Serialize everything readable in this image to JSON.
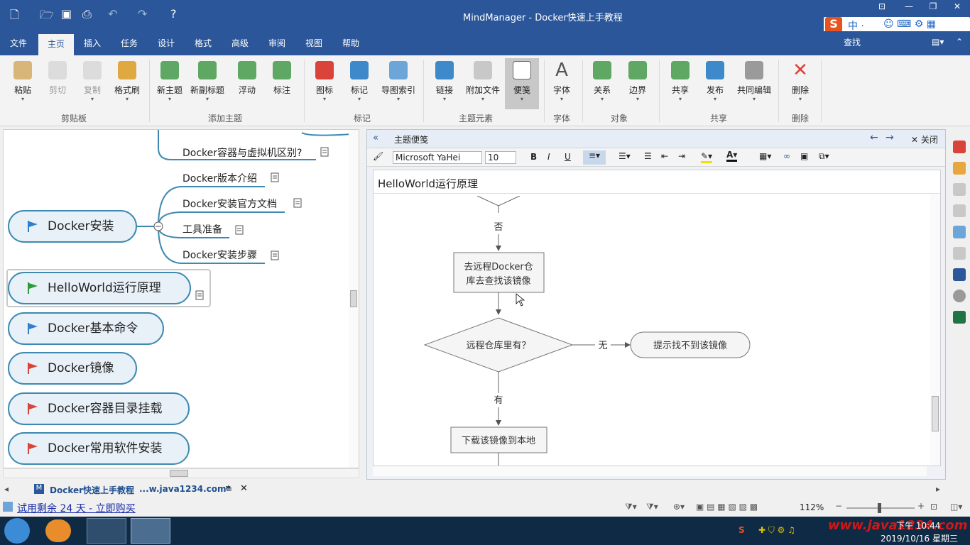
{
  "app": {
    "title": "MindManager - Docker快速上手教程"
  },
  "menu": {
    "items": [
      "文件",
      "主页",
      "插入",
      "任务",
      "设计",
      "格式",
      "高级",
      "审阅",
      "视图",
      "帮助"
    ],
    "search_label": "查找"
  },
  "ribbon": {
    "buttons": [
      "粘贴",
      "剪切",
      "复制",
      "格式刷",
      "新主题",
      "新副标题",
      "浮动",
      "标注",
      "图标",
      "标记",
      "导图索引",
      "链接",
      "附加文件",
      "便笺",
      "字体",
      "关系",
      "边界",
      "共享",
      "发布",
      "共同编辑",
      "删除"
    ],
    "groups": [
      "剪贴板",
      "添加主题",
      "标记",
      "主题元素",
      "字体",
      "对象",
      "共享",
      "删除"
    ]
  },
  "map": {
    "subtopics": [
      "Docker容器与虚拟机区别?",
      "Docker版本介绍",
      "Docker安装官方文档",
      "工具准备",
      "Docker安装步骤"
    ],
    "topics": [
      "Docker安装",
      "HelloWorld运行原理",
      "Docker基本命令",
      "Docker镜像",
      "Docker容器目录挂载",
      "Docker常用软件安装"
    ]
  },
  "note": {
    "header_title": "主题便笺",
    "close_label": "关闭",
    "font_name": "Microsoft YaHei",
    "font_size": "10",
    "title": "HelloWorld运行原理",
    "flow": {
      "no_label": "否",
      "box1_line1": "去远程Docker仓",
      "box1_line2": "库去查找该镜像",
      "decision": "远程仓库里有？",
      "none_label": "无",
      "not_found": "提示找不到该镜像",
      "yes_label": "有",
      "download": "下载该镜像到本地"
    }
  },
  "doc_tab": {
    "name": "Docker快速上手教程",
    "path": "...w.java1234.com*"
  },
  "status": {
    "trial": "试用剩余 24 天 - 立即购买",
    "zoom": "112%"
  },
  "taskbar": {
    "time": "下午 10:44",
    "date": "2019/10/16 星期三",
    "watermark": "www.java1234.com"
  },
  "colors": {
    "accent": "#2b579a",
    "topic_border": "#3e89b0",
    "flag_blue": "#2f7fd0",
    "flag_green": "#2e9a3c",
    "flag_red": "#d9433a"
  }
}
